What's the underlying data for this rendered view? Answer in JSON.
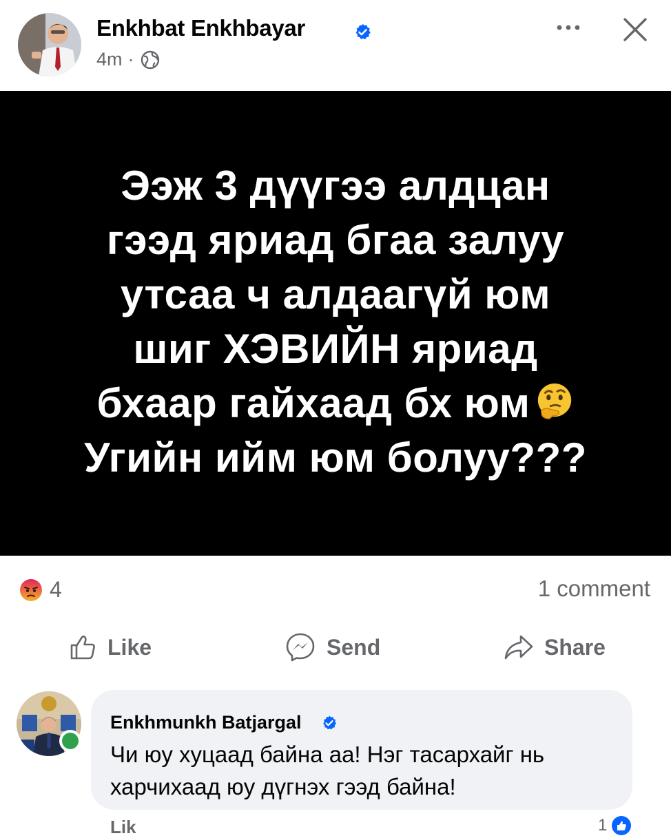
{
  "post": {
    "author": "Enkhbat Enkhbayar",
    "time": "4m",
    "separator": "·",
    "media_text": "Ээж 3 дүүгээ алдцан\nгээд яриад бгаа залуу\nутсаа ч алдаагүй юм\nшиг ХЭВИЙН яриад\nбхаар гайхаад бх юм",
    "media_text_last": "Угийн ийм юм болуу???",
    "reaction_count": "4",
    "comment_count": "1 comment"
  },
  "actions": {
    "like": "Like",
    "send": "Send",
    "share": "Share"
  },
  "comment": {
    "author": "Enkhmunkh Batjargal",
    "text": "Чи юу хуцаад байна аа! Нэг тасархайг нь харчихаад юу дүгнэх гээд байна!",
    "below_label": "Lik",
    "reaction_count": "1"
  },
  "colors": {
    "accent": "#0866ff",
    "secondary_text": "#65676b",
    "comment_bg": "#f0f2f5",
    "online": "#31a24c",
    "angry": "#e9710f"
  },
  "icons": [
    "verified-badge-icon",
    "globe-icon",
    "more-options-icon",
    "close-icon",
    "angry-reaction-icon",
    "like-thumb-icon",
    "messenger-icon",
    "share-arrow-icon",
    "thinking-face-emoji"
  ]
}
